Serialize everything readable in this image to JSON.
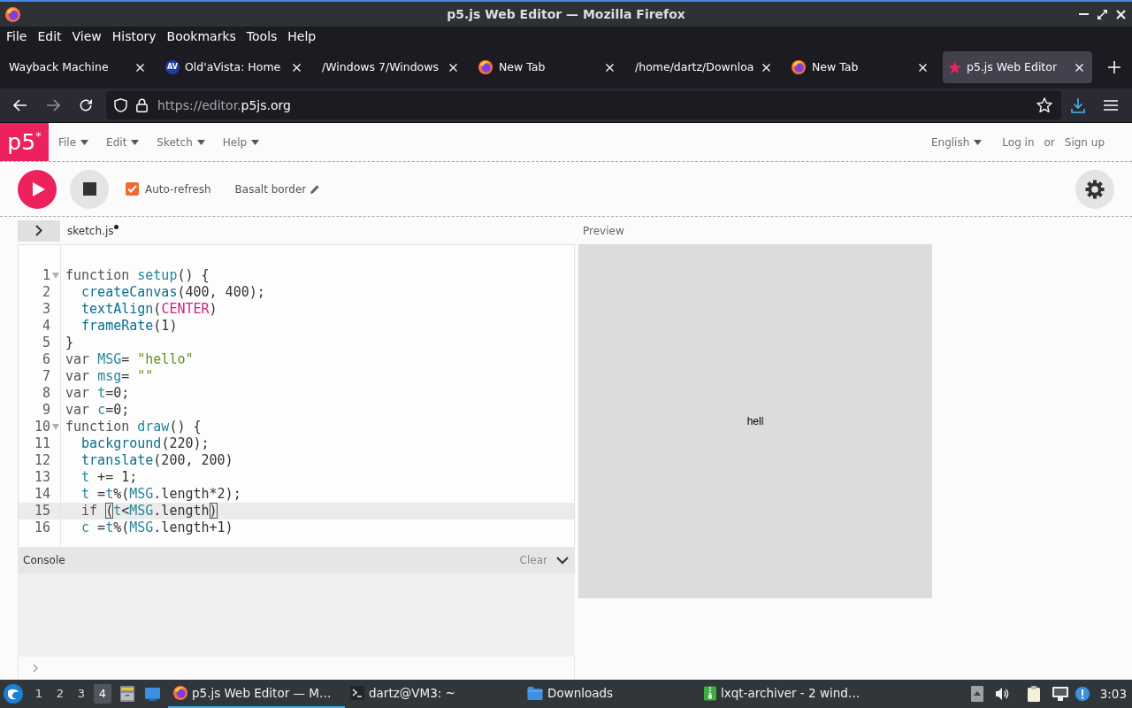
{
  "window": {
    "title": "p5.js Web Editor — Mozilla Firefox"
  },
  "menu_bar": [
    "File",
    "Edit",
    "View",
    "History",
    "Bookmarks",
    "Tools",
    "Help"
  ],
  "tabs": [
    {
      "label": "Wayback Machine",
      "kind": "plain",
      "selected": false
    },
    {
      "label": "Old'aVista: Home",
      "kind": "lettered",
      "icon_text": "AV",
      "selected": false
    },
    {
      "label": "/Windows 7/Windows",
      "kind": "plain",
      "selected": false
    },
    {
      "label": "New Tab",
      "kind": "firefox",
      "selected": false
    },
    {
      "label": "/home/dartz/Downloa",
      "kind": "plain",
      "selected": false
    },
    {
      "label": "New Tab",
      "kind": "firefox",
      "selected": false
    },
    {
      "label": "p5.js Web Editor",
      "kind": "p5",
      "selected": true
    }
  ],
  "nav_buttons": [
    {
      "kind": "back",
      "disabled": false
    },
    {
      "kind": "forward",
      "disabled": true
    },
    {
      "kind": "reload",
      "disabled": false
    }
  ],
  "address_bar": {
    "url": "https://editor.**p5js.org**"
  },
  "p5_header": {
    "logo": "p5$^{*}$",
    "menu": [
      "File",
      "Edit",
      "Sketch",
      "Help"
    ],
    "language": "English",
    "log_in": "Log in",
    "separator": "or",
    "sign_up": "Sign up"
  },
  "toolbar": {
    "auto_refresh": {
      "label": "Auto-refresh",
      "checked": true
    },
    "sketch_name": "Basalt border"
  },
  "editor": {
    "file_name": "sketch.js",
    "unsaved": true,
    "lines": [
      {
        "number": "1",
        "fold": true,
        "current": false,
        "tokens": [
          {
            "kind": "keyword",
            "text": "function "
          },
          {
            "kind": "def",
            "text": "setup"
          },
          {
            "kind": "plain",
            "text": "() {"
          }
        ]
      },
      {
        "number": "2",
        "fold": false,
        "current": false,
        "tokens": [
          {
            "kind": "builtin",
            "text": "  createCanvas"
          },
          {
            "kind": "plain",
            "text": "(400, 400);"
          }
        ]
      },
      {
        "number": "3",
        "fold": false,
        "current": false,
        "tokens": [
          {
            "kind": "builtin",
            "text": "  textAlign"
          },
          {
            "kind": "plain",
            "text": "("
          },
          {
            "kind": "constant",
            "text": "CENTER"
          },
          {
            "kind": "plain",
            "text": ")"
          }
        ]
      },
      {
        "number": "4",
        "fold": false,
        "current": false,
        "tokens": [
          {
            "kind": "builtin",
            "text": "  frameRate"
          },
          {
            "kind": "plain",
            "text": "(1)"
          }
        ]
      },
      {
        "number": "5",
        "fold": false,
        "current": false,
        "tokens": [
          {
            "kind": "plain",
            "text": "}"
          }
        ]
      },
      {
        "number": "6",
        "fold": false,
        "current": false,
        "tokens": [
          {
            "kind": "keyword",
            "text": "var "
          },
          {
            "kind": "variable",
            "text": "MSG"
          },
          {
            "kind": "plain",
            "text": "= "
          },
          {
            "kind": "string",
            "text": "\"hello\""
          }
        ]
      },
      {
        "number": "7",
        "fold": false,
        "current": false,
        "tokens": [
          {
            "kind": "keyword",
            "text": "var "
          },
          {
            "kind": "variable",
            "text": "msg"
          },
          {
            "kind": "plain",
            "text": "= "
          },
          {
            "kind": "string",
            "text": "\"\""
          }
        ]
      },
      {
        "number": "8",
        "fold": false,
        "current": false,
        "tokens": [
          {
            "kind": "keyword",
            "text": "var "
          },
          {
            "kind": "variable",
            "text": "t"
          },
          {
            "kind": "plain",
            "text": "=0;"
          }
        ]
      },
      {
        "number": "9",
        "fold": false,
        "current": false,
        "tokens": [
          {
            "kind": "keyword",
            "text": "var "
          },
          {
            "kind": "variable",
            "text": "c"
          },
          {
            "kind": "plain",
            "text": "=0;"
          }
        ]
      },
      {
        "number": "10",
        "fold": true,
        "current": false,
        "tokens": [
          {
            "kind": "keyword",
            "text": "function "
          },
          {
            "kind": "def",
            "text": "draw"
          },
          {
            "kind": "plain",
            "text": "() {"
          }
        ]
      },
      {
        "number": "11",
        "fold": false,
        "current": false,
        "tokens": [
          {
            "kind": "builtin",
            "text": "  background"
          },
          {
            "kind": "plain",
            "text": "(220);"
          }
        ]
      },
      {
        "number": "12",
        "fold": false,
        "current": false,
        "tokens": [
          {
            "kind": "builtin",
            "text": "  translate"
          },
          {
            "kind": "plain",
            "text": "(200, 200)"
          }
        ]
      },
      {
        "number": "13",
        "fold": false,
        "current": false,
        "tokens": [
          {
            "kind": "variable",
            "text": "  t"
          },
          {
            "kind": "plain",
            "text": " += 1;"
          }
        ]
      },
      {
        "number": "14",
        "fold": false,
        "current": false,
        "tokens": [
          {
            "kind": "variable",
            "text": "  t"
          },
          {
            "kind": "plain",
            "text": " ="
          },
          {
            "kind": "variable",
            "text": "t"
          },
          {
            "kind": "plain",
            "text": "%("
          },
          {
            "kind": "variable",
            "text": "MSG"
          },
          {
            "kind": "plain",
            "text": ".length*2);"
          }
        ]
      },
      {
        "number": "15",
        "fold": false,
        "current": true,
        "tokens": [
          {
            "kind": "keyword",
            "text": "  if "
          },
          {
            "kind": "bracket",
            "text": "("
          },
          {
            "kind": "variable",
            "text": "t"
          },
          {
            "kind": "plain",
            "text": "<"
          },
          {
            "kind": "variable",
            "text": "MSG"
          },
          {
            "kind": "plain",
            "text": ".length"
          },
          {
            "kind": "bracket",
            "text": ")"
          }
        ]
      },
      {
        "number": "16",
        "fold": false,
        "current": false,
        "tokens": [
          {
            "kind": "variable",
            "text": "  c"
          },
          {
            "kind": "plain",
            "text": " ="
          },
          {
            "kind": "variable",
            "text": "t"
          },
          {
            "kind": "plain",
            "text": "%("
          },
          {
            "kind": "variable",
            "text": "MSG"
          },
          {
            "kind": "plain",
            "text": ".length+1)"
          }
        ]
      }
    ]
  },
  "console": {
    "title": "Console",
    "clear": "Clear"
  },
  "preview": {
    "label": "Preview",
    "canvas_text": "hell"
  },
  "taskbar": {
    "desktops": [
      {
        "label": "1",
        "selected": false
      },
      {
        "label": "2",
        "selected": false
      },
      {
        "label": "3",
        "selected": false
      },
      {
        "label": "4",
        "selected": true
      }
    ],
    "tasks": [
      {
        "label": "p5.js Web Editor — M…",
        "kind": "firefox",
        "selected": true
      },
      {
        "label": "dartz@VM3: ~",
        "kind": "terminal",
        "selected": false
      },
      {
        "label": "Downloads",
        "kind": "folder",
        "selected": false
      },
      {
        "label": "lxqt-archiver - 2 wind…",
        "kind": "archiver",
        "selected": false
      }
    ],
    "clock": "3:03"
  }
}
